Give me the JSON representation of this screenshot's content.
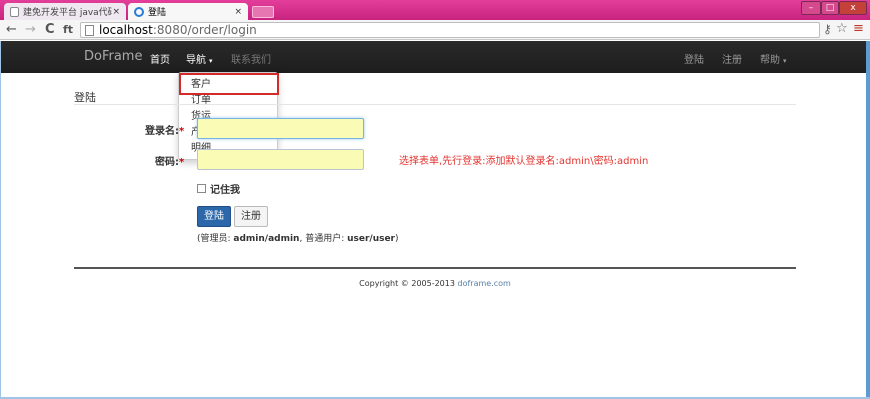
{
  "browser": {
    "tabs": [
      {
        "label": "建免开发平台 java代码生",
        "close": "×"
      },
      {
        "label": "登陆",
        "close": "×"
      }
    ],
    "url_host": "localhost",
    "url_path": ":8080/order/login",
    "nav_back": "←",
    "nav_forward": "→",
    "nav_reload": "C",
    "nav_home": "ft",
    "bookmark_star": "☆",
    "menu": "≡",
    "key": "⚷",
    "win_min": "–",
    "win_max": "□",
    "win_close": "x"
  },
  "navbar": {
    "brand": "DoFrame",
    "home": "首页",
    "nav": "导航",
    "contact": "联系我们",
    "login": "登陆",
    "register": "注册",
    "help": "帮助",
    "caret": "▾"
  },
  "dropdown": {
    "items": [
      "客户",
      "订单",
      "货运",
      "产品",
      "明细"
    ]
  },
  "form": {
    "legend": "登陆",
    "username_label": "登录名:",
    "password_label": "密码:",
    "required_mark": "*",
    "remember_label": "记住我",
    "login_button": "登陆",
    "register_button": "注册",
    "hint_prefix": "(管理员: ",
    "hint_admin": "admin/admin",
    "hint_middle": ", 普通用户: ",
    "hint_user": "user/user",
    "hint_suffix": ")"
  },
  "annotation": {
    "note": "选择表单,先行登录:添加默认登录名:admin\\密码:admin"
  },
  "footer": {
    "copyright": "Copyright © 2005-2013 ",
    "link": "doframe.com"
  },
  "colors": {
    "titlebar": "#d02a86",
    "navbar": "#222222",
    "primary_button": "#2b67a9",
    "highlight_box": "#d42a2a",
    "note_text": "#e3342f",
    "field_autofill": "#fafcb6"
  }
}
